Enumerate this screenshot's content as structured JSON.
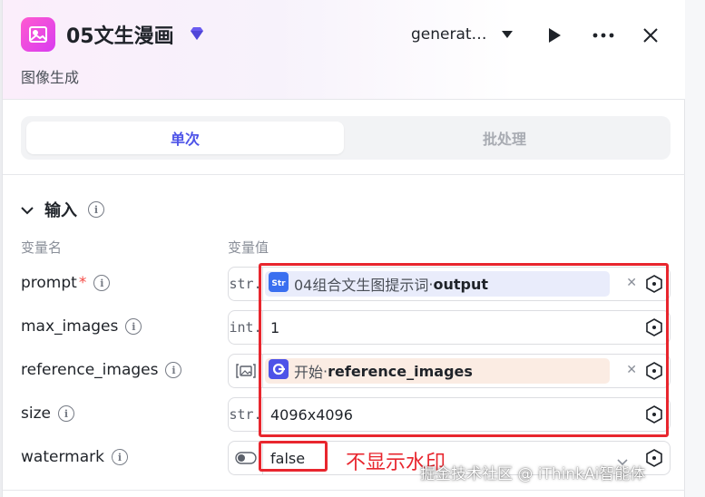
{
  "header": {
    "title": "05文生漫画",
    "subtitle": "图像生成",
    "model_select": "generat…",
    "app_icon": "image-icon",
    "badge_icon": "gem-icon"
  },
  "tabs": [
    {
      "label": "单次",
      "active": true
    },
    {
      "label": "批处理",
      "active": false
    }
  ],
  "section": {
    "title": "输入",
    "col_name": "变量名",
    "col_value": "变量值"
  },
  "rows": [
    {
      "name": "prompt",
      "required": "*",
      "type": "str.",
      "chip_source": "04组合文生图提示词",
      "chip_sep": " · ",
      "chip_var": "output"
    },
    {
      "name": "max_images",
      "type": "int.",
      "value": "1"
    },
    {
      "name": "reference_images",
      "type_icon": "image-list-icon",
      "chip_source": "开始",
      "chip_sep": " · ",
      "chip_var": "reference_images"
    },
    {
      "name": "size",
      "type": "str.",
      "value": "4096x4096"
    },
    {
      "name": "watermark",
      "type_icon": "toggle-icon",
      "value": "false"
    }
  ],
  "annotation": "不显示水印",
  "watermark_text": "掘金技术社区 @ iThinkAi智能体",
  "colors": {
    "accent": "#4d53e8",
    "annotation_red": "#e8262e",
    "app_icon_pink": "#e84ae0",
    "chip_blue_bg": "#e9ecfb",
    "chip_orange_bg": "#fbece3"
  }
}
